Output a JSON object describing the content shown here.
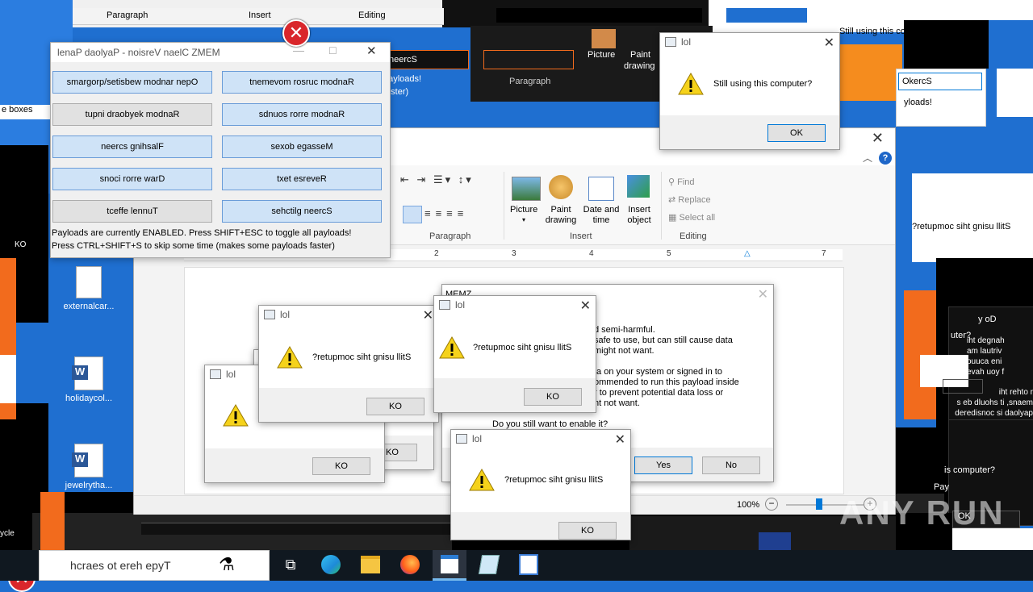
{
  "memz_panel": {
    "title": "lenaP daolyaP - noisreV naelC ZMEM",
    "buttons": [
      {
        "label": "smargorp/setisbew modnar nepO",
        "enabled": true
      },
      {
        "label": "tnemevom rosruc modnaR",
        "enabled": true
      },
      {
        "label": "tupni draobyek modnaR",
        "enabled": false
      },
      {
        "label": "sdnuos rorre modnaR",
        "enabled": true
      },
      {
        "label": "neercs gnihsalF",
        "enabled": true
      },
      {
        "label": "sexob egasseM",
        "enabled": true
      },
      {
        "label": "snoci rorre warD",
        "enabled": true
      },
      {
        "label": "txet esreveR",
        "enabled": true
      },
      {
        "label": "tceffe lennuT",
        "enabled": false
      },
      {
        "label": "sehctilg neercS",
        "enabled": true
      }
    ],
    "status_line1": "Payloads are currently ENABLED. Press SHIFT+ESC to toggle all payloads!",
    "status_line2": "Press CTRL+SHIFT+S to skip some time (makes some payloads faster)"
  },
  "wordpad": {
    "top_tabs": [
      "Paragraph",
      "Insert",
      "Editing"
    ],
    "ribbon": {
      "paragraph_label": "Paragraph",
      "insert_label": "Insert",
      "editing_label": "Editing",
      "picture": "Picture",
      "paint_drawing": "Paint drawing",
      "date_time": "Date and time",
      "insert_object": "Insert object",
      "find": "Find",
      "replace": "Replace",
      "select_all": "Select all"
    },
    "ruler_marks": [
      "2",
      "3",
      "4",
      "5",
      "6",
      "7"
    ],
    "zoom": "100%"
  },
  "memz_warning": {
    "title": "MEMZ",
    "lines": [
      "d semi-harmful.",
      "safe to use, but can still cause data",
      "might not want.",
      "ta on your system or signed in to",
      "ommended to run this payload inside",
      "r to prevent potential data loss or",
      "nt not want."
    ],
    "question": "Do you still want to enable it?",
    "yes": "Yes",
    "no": "No"
  },
  "dialogs": {
    "title": "lol",
    "reversed_msg": "?retupmoc siht gnisu llitS",
    "normal_msg": "Still using this computer?",
    "ok_reversed": "KO",
    "ok_normal": "OK"
  },
  "background_fragments": {
    "screen_reversed": "neercS",
    "payloads": "payloads!",
    "faster": "faster)",
    "still_using": "Still using this compu",
    "kohercs": "OkercS",
    "payloads2": "yloads!",
    "text_box": "e boxes",
    "ko": "KO",
    "right_msg": "?retupmoc siht gnisu llitS",
    "do_you": "y oD",
    "right_lines": [
      "iht degnah",
      "am lautriv",
      "ouuca eni",
      "evah uoy f"
    ],
    "right_lines2": [
      "iht rehto r",
      "s eb dluohs ti ,snaem",
      "deredisnoc si daolyap"
    ],
    "is_computer": "is computer?",
    "pay": "Pay",
    "is_computer2": "uter?",
    "ok2": "OK",
    "cycle": "ycle"
  },
  "desktop": {
    "icons": [
      "externalcar...",
      "holidaycol...",
      "jewelrytha..."
    ]
  },
  "taskbar": {
    "search_placeholder": "hcraes ot ereh epyT"
  },
  "watermark": "ANY RUN",
  "colors": {
    "accent": "#0078d7",
    "desktop": "#1f6fd0",
    "orange": "#f26b1d"
  }
}
